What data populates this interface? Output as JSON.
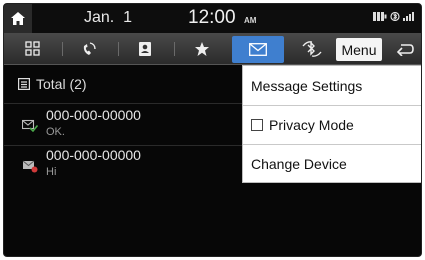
{
  "status_bar": {
    "date": "Jan.  1",
    "time": "12:00",
    "ampm": "AM",
    "icons": [
      "home-icon",
      "battery-icon",
      "bluetooth-icon",
      "signal-icon"
    ]
  },
  "tabs": [
    {
      "icon": "keypad-icon",
      "active": false
    },
    {
      "icon": "call-history-icon",
      "active": false
    },
    {
      "icon": "contacts-icon",
      "active": false
    },
    {
      "icon": "favorites-star-icon",
      "active": false
    },
    {
      "icon": "messages-envelope-icon",
      "active": true
    },
    {
      "icon": "bluetooth-settings-icon",
      "active": false
    }
  ],
  "toolbar": {
    "menu_label": "Menu",
    "back_icon": "back-arrow-icon"
  },
  "list": {
    "total_label": "Total (2)",
    "messages": [
      {
        "number": "000-000-00000",
        "preview": "OK.",
        "icon": "message-read-icon"
      },
      {
        "number": "000-000-00000",
        "preview": "Hi",
        "icon": "message-unread-icon"
      }
    ]
  },
  "dropdown": {
    "items": [
      {
        "label": "Message Settings"
      },
      {
        "label": "Privacy Mode",
        "checked": false
      },
      {
        "label": "Change Device"
      }
    ]
  },
  "colors": {
    "active_tab": "#3f7fcf",
    "background": "#070707"
  }
}
